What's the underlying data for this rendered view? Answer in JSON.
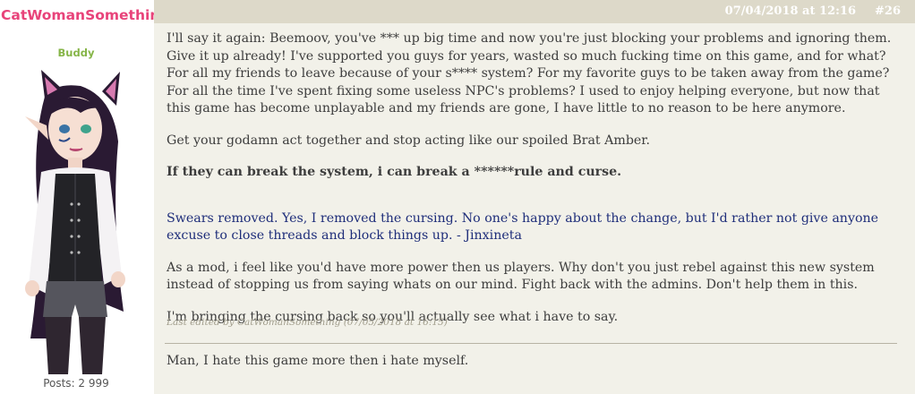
{
  "user": {
    "name": "CatWomanSomething",
    "role": "Buddy",
    "posts": "Posts: 2 999"
  },
  "header": {
    "date": "07/04/2018 at 12:16",
    "post_number": "#26"
  },
  "message": {
    "p1": "I'll say it again: Beemoov, you've *** up big time and now you're just blocking your problems and ignoring them. Give it up already! I've supported you guys for years, wasted so much fucking time on this game, and for what? For all my friends to leave because of your s**** system? For my favorite guys to be taken away from the game? For all the time I've spent fixing some useless NPC's problems? I used to enjoy helping everyone, but now that this game has become unplayable and my friends are gone, I have little to no reason to be here anymore.",
    "p2": "Get your godamn act together and stop acting like our spoiled Brat Amber.",
    "p3": "If they can break the system, i can break a ******rule and curse.",
    "p4": "Swears removed. Yes, I removed the cursing. No one's happy about the change, but I'd rather not give anyone excuse to close threads and block things up. - Jinxineta",
    "p5": "As a mod, i feel like you'd have more power then us players. Why don't you just rebel against this new system instead of stopping us from saying whats on our mind. Fight back with the admins. Don't help them in this.",
    "p6": "I'm bringing the cursing back so you'll actually see what i have to say.",
    "edited": "Last edited by CatWomanSomething (07/05/2018 at 16:15)"
  },
  "signature": "Man, I hate this game more then i hate myself.",
  "colors": {
    "username": "#e8437a",
    "role": "#86b548",
    "header_bg": "#ddd9c9",
    "body_bg": "#f2f1e9",
    "mod_text": "#1f2e7a"
  }
}
